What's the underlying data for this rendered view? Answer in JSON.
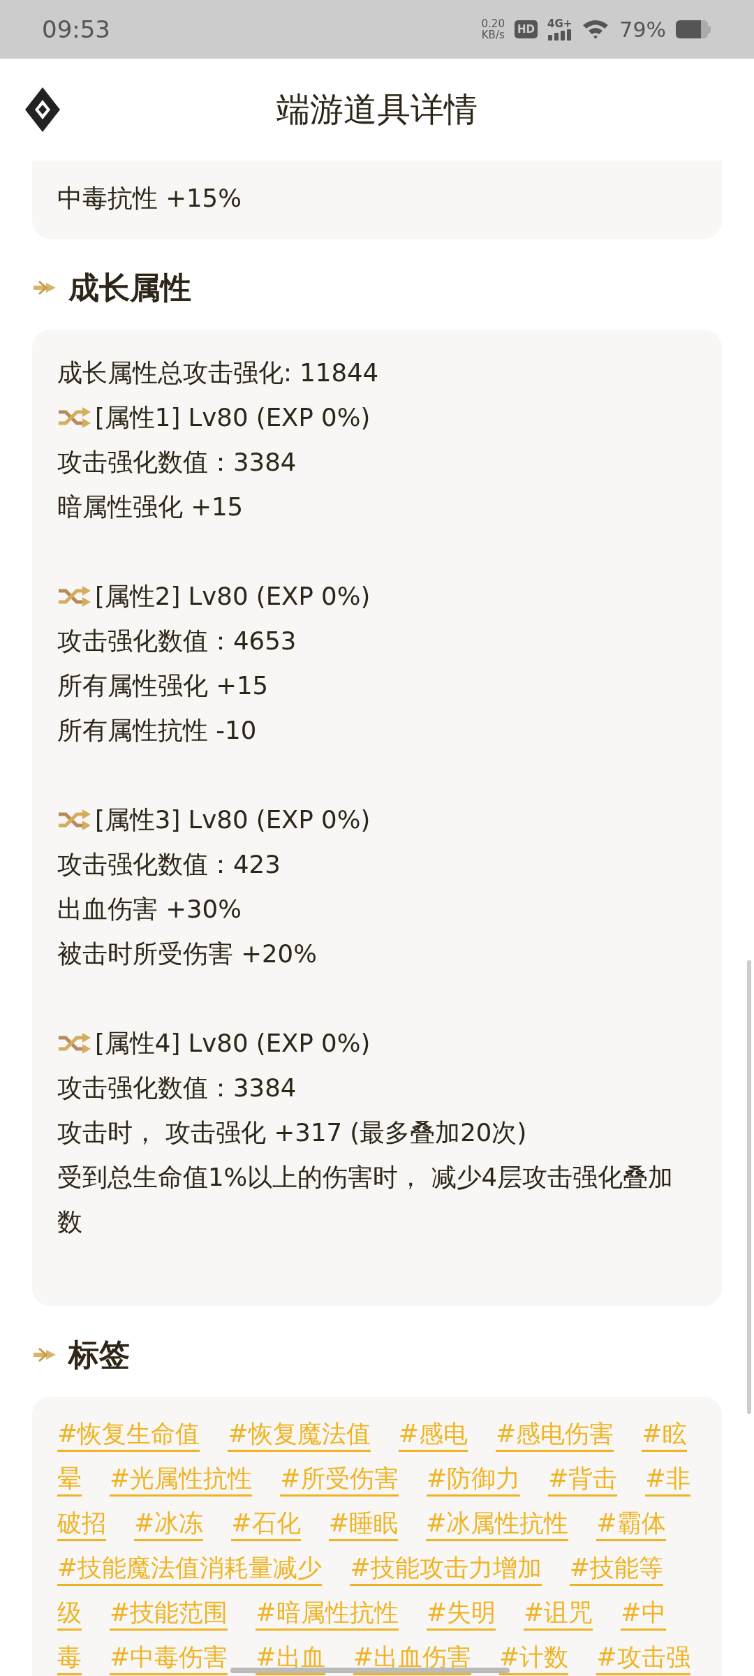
{
  "status_bar": {
    "time": "09:53",
    "speed": "0.20",
    "speed_unit": "KB/s",
    "hd": "HD",
    "network": "4G+",
    "battery": "79%"
  },
  "header": {
    "title": "端游道具详情"
  },
  "top_card": {
    "lines": [
      "中毒抗性 +15%"
    ]
  },
  "growth": {
    "title": "成长属性",
    "total": "成长属性总攻击强化: 11844",
    "attributes": [
      {
        "header": "[属性1] Lv80 (EXP 0%)",
        "lines": [
          "攻击强化数值：3384",
          "暗属性强化 +15"
        ]
      },
      {
        "header": "[属性2] Lv80 (EXP 0%)",
        "lines": [
          "攻击强化数值：4653",
          "所有属性强化 +15",
          "所有属性抗性 -10"
        ]
      },
      {
        "header": "[属性3] Lv80 (EXP 0%)",
        "lines": [
          "攻击强化数值：423",
          "出血伤害 +30%",
          "被击时所受伤害 +20%"
        ]
      },
      {
        "header": "[属性4] Lv80 (EXP 0%)",
        "lines": [
          "攻击强化数值：3384",
          "攻击时， 攻击强化 +317 (最多叠加20次)",
          "受到总生命值1%以上的伤害时， 减少4层攻击强化叠加数"
        ]
      }
    ]
  },
  "tags": {
    "title": "标签",
    "text_lines": [
      {
        "tags": [
          "#恢复生命值",
          "#恢复魔法值",
          "#感电",
          "#感电伤害",
          "#眩"
        ]
      },
      {
        "tags": [
          "晕",
          "#光属性抗性",
          "#所受伤害",
          "#防御力",
          "#背击",
          "#非"
        ]
      },
      {
        "tags": [
          "破招",
          "#冰冻",
          "#石化",
          "#睡眠",
          "#冰属性抗性",
          "#霸体"
        ]
      },
      {
        "tags": [
          "#技能魔法值消耗量减少",
          "#技能攻击力增加",
          "#技能等"
        ]
      },
      {
        "tags": [
          "级",
          "#技能范围",
          "#暗属性抗性",
          "#失明",
          "#诅咒",
          "#中"
        ]
      },
      {
        "tags": [
          "毒",
          "#中毒伤害",
          "#出血",
          "#出血伤害",
          "#计数",
          "#攻击强"
        ]
      }
    ]
  }
}
